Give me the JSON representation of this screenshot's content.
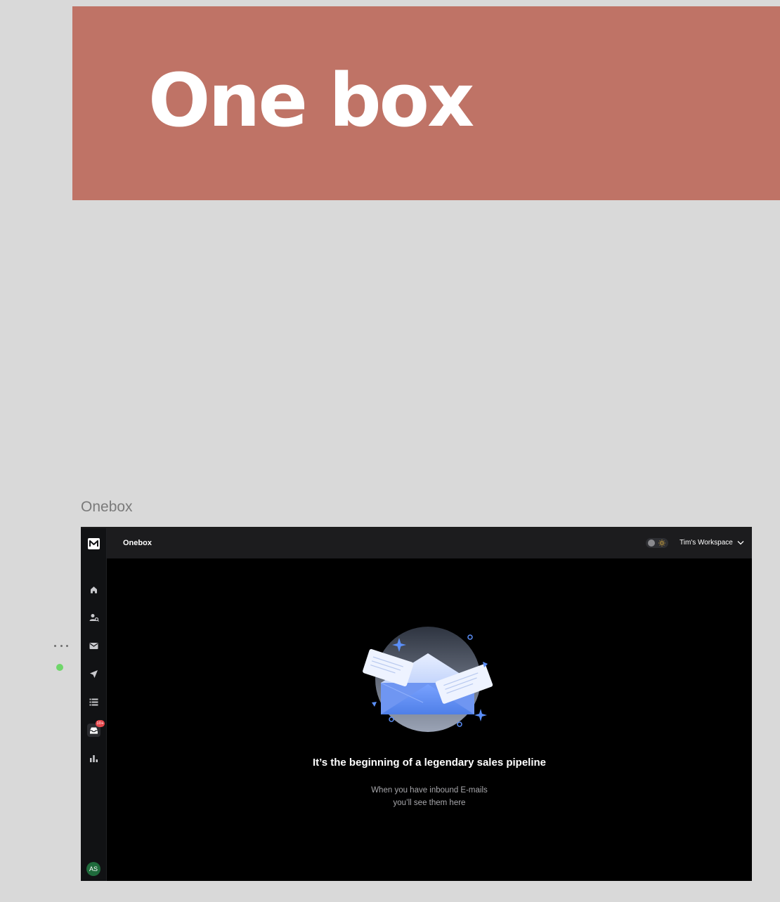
{
  "hero": {
    "title": "One box"
  },
  "frame": {
    "label": "Onebox"
  },
  "sidebar": {
    "logo": "mail-logo-icon",
    "items": [
      {
        "name": "home",
        "icon": "home-icon"
      },
      {
        "name": "lead-finder",
        "icon": "user-search-icon"
      },
      {
        "name": "email",
        "icon": "mail-icon"
      },
      {
        "name": "campaigns",
        "icon": "send-icon"
      },
      {
        "name": "lists",
        "icon": "list-icon"
      },
      {
        "name": "onebox",
        "icon": "inbox-icon",
        "active": true,
        "badge": "10+"
      },
      {
        "name": "analytics",
        "icon": "bar-chart-icon"
      }
    ],
    "avatar_initials": "AS"
  },
  "topbar": {
    "title": "Onebox",
    "workspace": "Tim's Workspace"
  },
  "empty_state": {
    "illustration": "envelope-illustration",
    "title": "It’s the beginning of a legendary sales pipeline",
    "subtitle_line1": "When you have inbound E-mails",
    "subtitle_line2": "you’ll see them here"
  },
  "colors": {
    "hero_bg": "#bf7366",
    "canvas_bg": "#d9d9d9",
    "app_bg": "#000000",
    "accent_blue": "#5b8ff9",
    "badge_red": "#e5484d",
    "avatar_green": "#1f6b3c"
  }
}
